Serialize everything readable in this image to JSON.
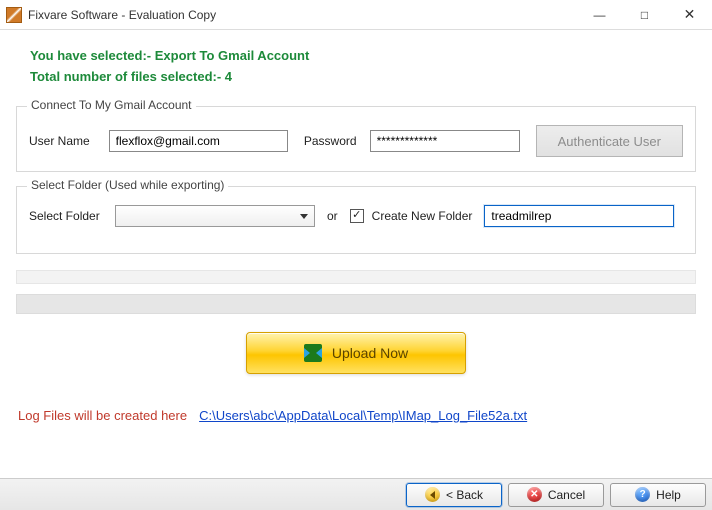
{
  "window": {
    "title": "Fixvare Software - Evaluation Copy"
  },
  "info": {
    "selected_line": "You have selected:- Export To Gmail Account",
    "count_line": "Total number of files selected:- 4"
  },
  "connect": {
    "legend": "Connect To My Gmail Account",
    "username_label": "User Name",
    "username_value": "flexflox@gmail.com",
    "password_label": "Password",
    "password_value": "*************",
    "auth_button": "Authenticate User"
  },
  "folder": {
    "legend": "Select Folder (Used while exporting)",
    "select_label": "Select Folder",
    "or_label": "or",
    "create_checked": true,
    "create_label": "Create New Folder",
    "new_folder_value": "treadmilrep"
  },
  "upload_button": "Upload Now",
  "log": {
    "prefix": "Log Files will be created here",
    "path": "C:\\Users\\abc\\AppData\\Local\\Temp\\IMap_Log_File52a.txt"
  },
  "footer": {
    "back": "< Back",
    "cancel": "Cancel",
    "help": "Help"
  }
}
